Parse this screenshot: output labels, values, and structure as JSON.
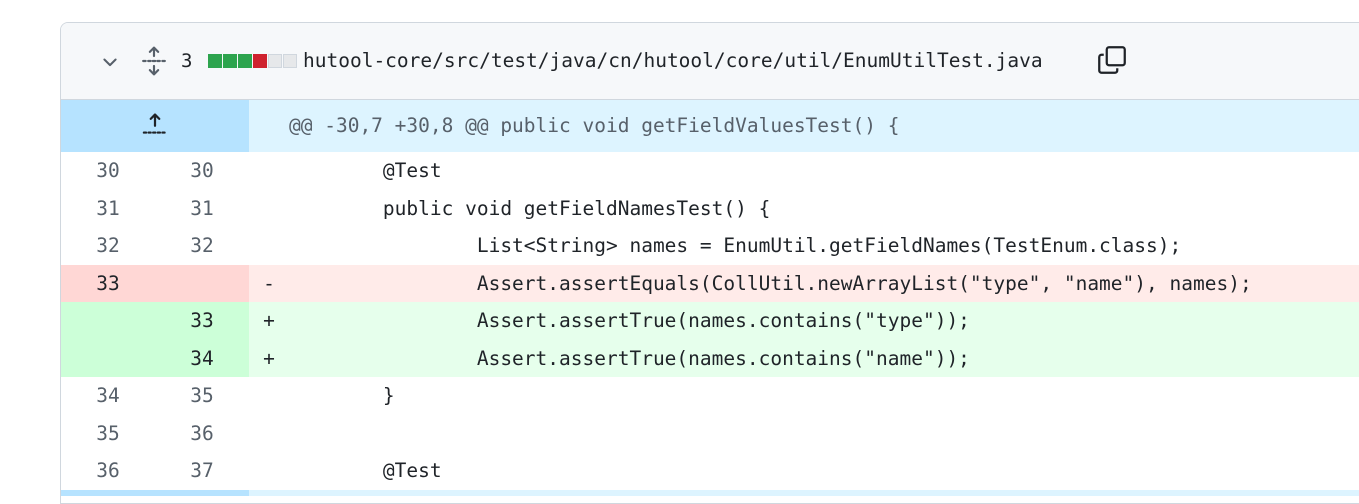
{
  "file": {
    "change_count": "3",
    "path": "hutool-core/src/test/java/cn/hutool/core/util/EnumUtilTest.java",
    "diffstat": [
      "#2da44e",
      "#2da44e",
      "#2da44e",
      "#cf222e",
      "#e6e8ea",
      "#e6e8ea"
    ]
  },
  "icons": {
    "collapse": "chevron-down-icon",
    "expand_all": "unfold-icon",
    "copy": "copy-icon",
    "expand_up": "fold-up-icon"
  },
  "hunk": {
    "header": "@@ -30,7 +30,8 @@ public void getFieldValuesTest() {"
  },
  "lines": [
    {
      "type": "context",
      "old": "30",
      "new": "30",
      "marker": "",
      "code": "\t@Test"
    },
    {
      "type": "context",
      "old": "31",
      "new": "31",
      "marker": "",
      "code": "\tpublic void getFieldNamesTest() {"
    },
    {
      "type": "context",
      "old": "32",
      "new": "32",
      "marker": "",
      "code": "\t\tList<String> names = EnumUtil.getFieldNames(TestEnum.class);"
    },
    {
      "type": "del",
      "old": "33",
      "new": "",
      "marker": "-",
      "code": "\t\tAssert.assertEquals(CollUtil.newArrayList(\"type\", \"name\"), names);"
    },
    {
      "type": "add",
      "old": "",
      "new": "33",
      "marker": "+",
      "code": "\t\tAssert.assertTrue(names.contains(\"type\"));"
    },
    {
      "type": "add",
      "old": "",
      "new": "34",
      "marker": "+",
      "code": "\t\tAssert.assertTrue(names.contains(\"name\"));"
    },
    {
      "type": "context",
      "old": "34",
      "new": "35",
      "marker": "",
      "code": "\t}"
    },
    {
      "type": "context",
      "old": "35",
      "new": "36",
      "marker": "",
      "code": ""
    },
    {
      "type": "context",
      "old": "36",
      "new": "37",
      "marker": "",
      "code": "\t@Test"
    }
  ]
}
